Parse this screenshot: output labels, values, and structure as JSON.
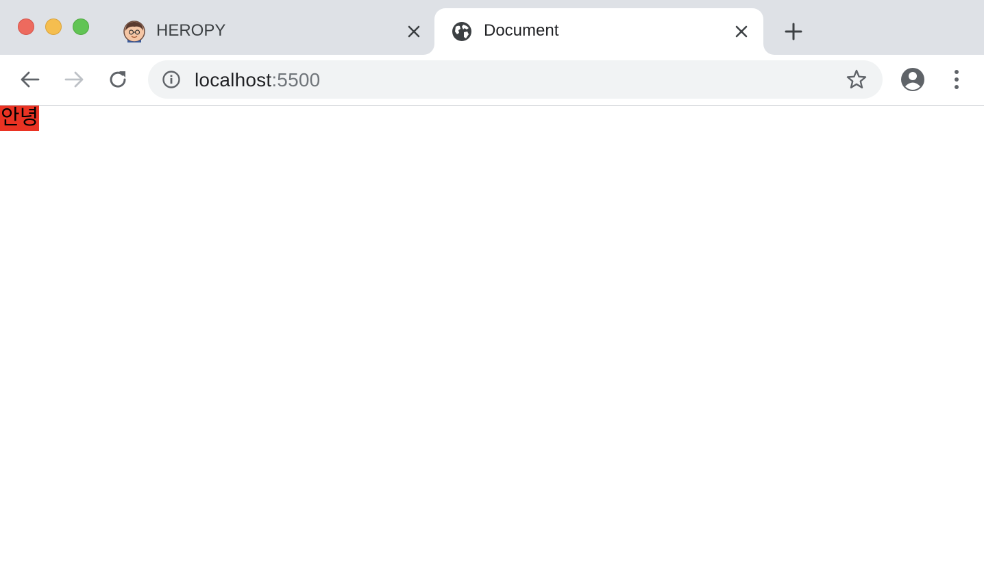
{
  "window": {
    "controls": [
      "close",
      "minimize",
      "zoom"
    ]
  },
  "tabs": [
    {
      "title": "HEROPY",
      "favicon": "avatar-icon",
      "active": false
    },
    {
      "title": "Document",
      "favicon": "globe-icon",
      "active": true
    }
  ],
  "toolbar": {
    "url_host": "localhost",
    "url_port": ":5500"
  },
  "page": {
    "text": "안녕",
    "highlight_color": "#ea3323"
  },
  "colors": {
    "tab_strip": "#dee1e6",
    "omnibox": "#f1f3f4",
    "icon": "#5f6368"
  }
}
